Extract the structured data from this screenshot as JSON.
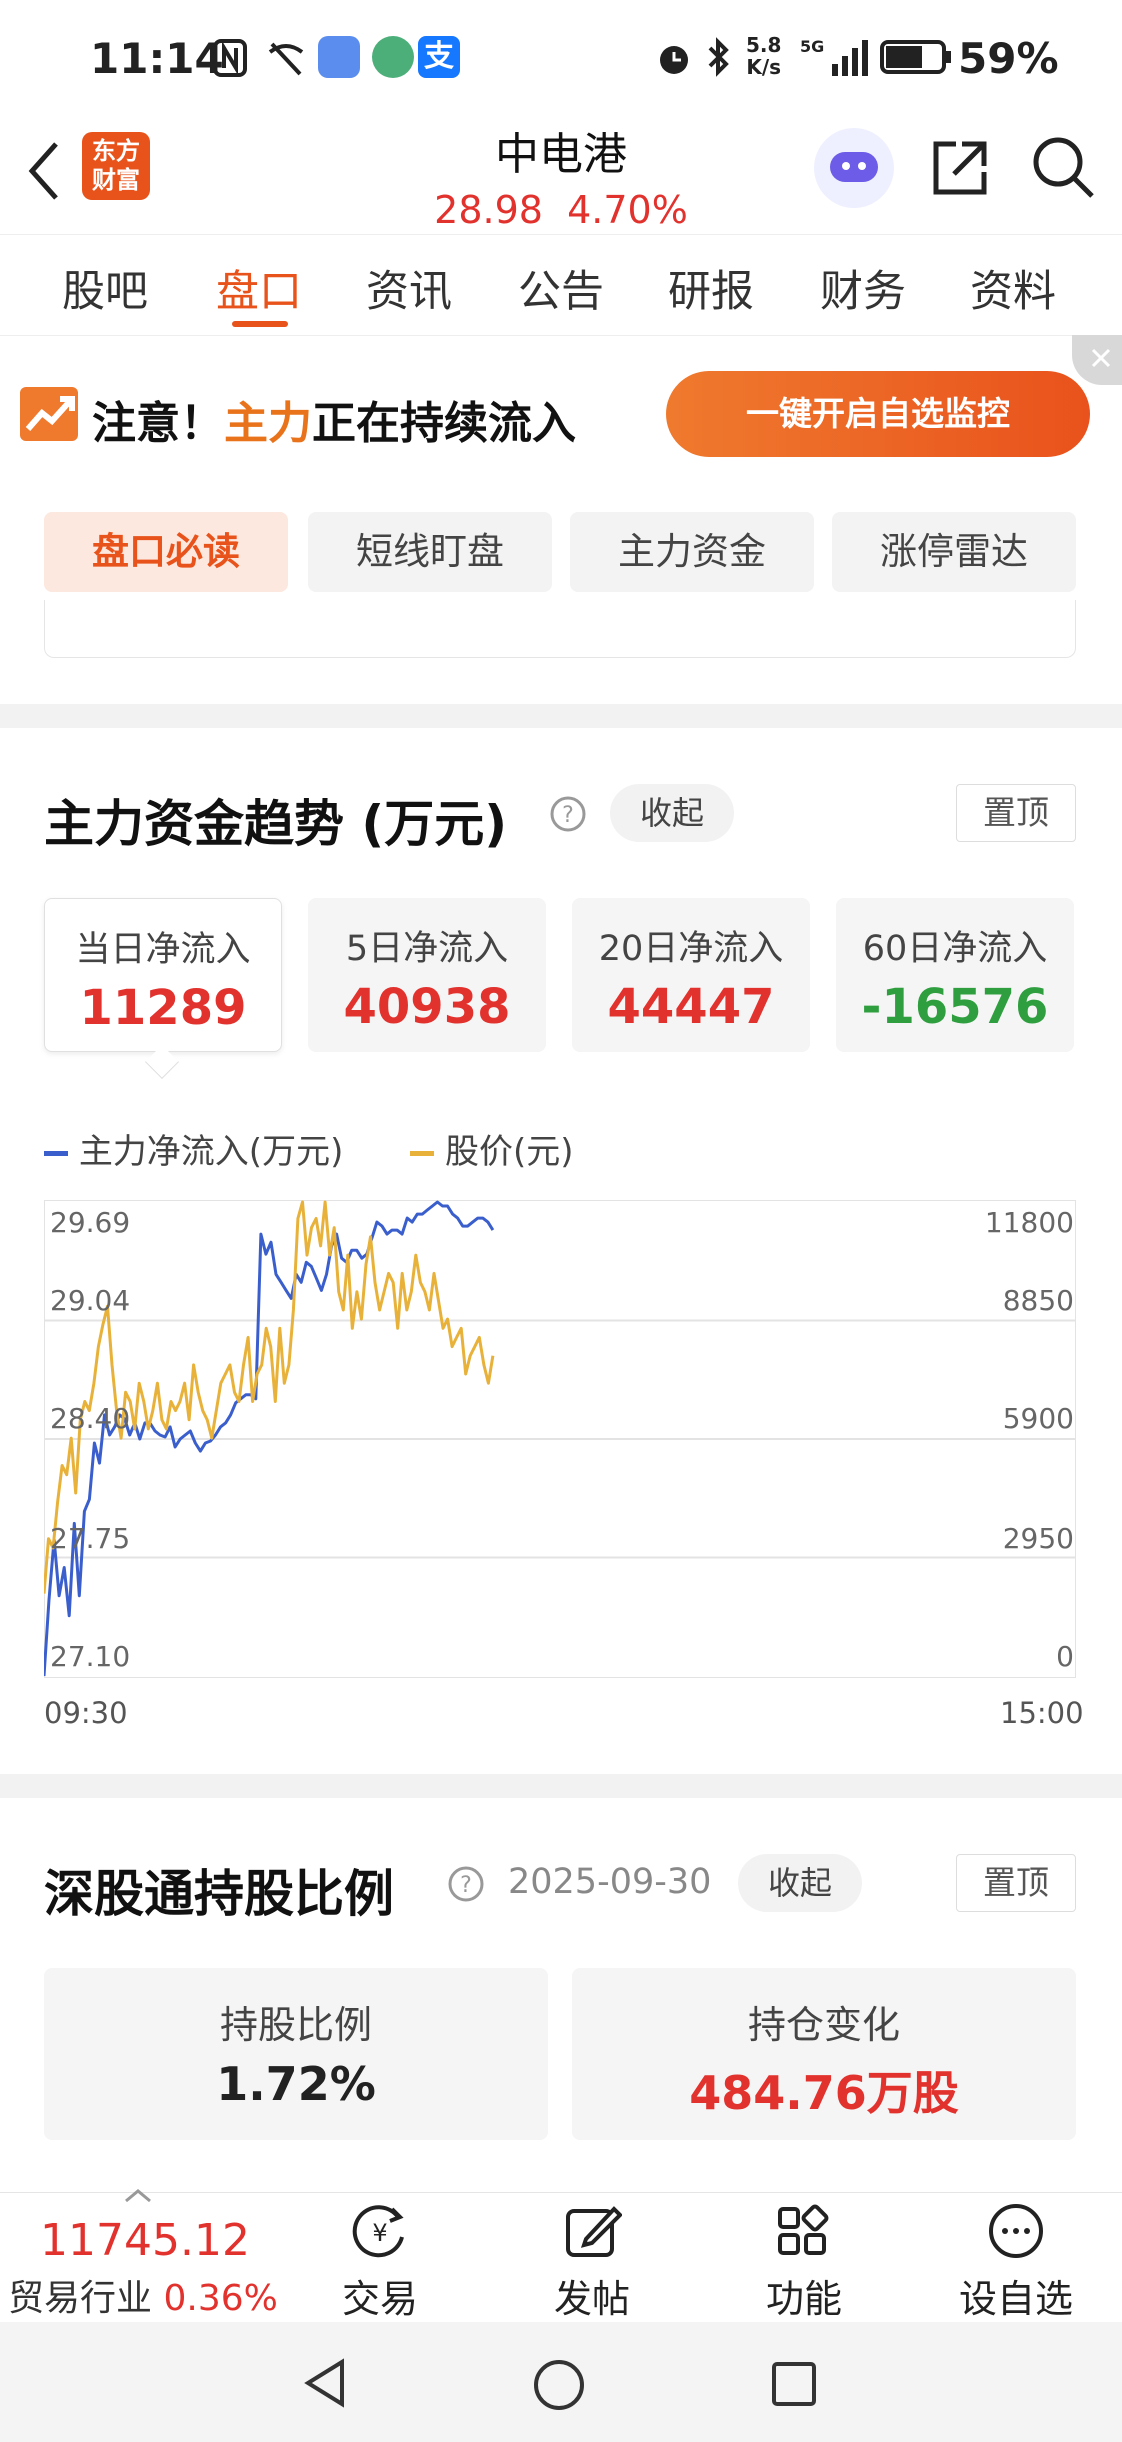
{
  "status_bar": {
    "time": "11:14",
    "net_speed_top": "5.8",
    "net_speed_unit": "K/s",
    "battery": "59%"
  },
  "header": {
    "logo_text_line1": "东方",
    "logo_text_line2": "财富",
    "stock_name": "中电港",
    "price": "28.98",
    "change_pct": "4.70%"
  },
  "tabs": [
    "股吧",
    "盘口",
    "资讯",
    "公告",
    "研报",
    "财务",
    "资料"
  ],
  "active_tab": "盘口",
  "banner": {
    "text_prefix": "注意！",
    "text_highlight": "主力",
    "text_suffix": "正在持续流入",
    "button_label": "一键开启自选监控"
  },
  "subtabs": [
    "盘口必读",
    "短线盯盘",
    "主力资金",
    "涨停雷达"
  ],
  "fund_trend": {
    "title": "主力资金趋势 (万元)",
    "collapse_label": "收起",
    "pin_label": "置顶",
    "cards": [
      {
        "label": "当日净流入",
        "value": "11289",
        "tone": "red"
      },
      {
        "label": "5日净流入",
        "value": "40938",
        "tone": "red"
      },
      {
        "label": "20日净流入",
        "value": "44447",
        "tone": "red"
      },
      {
        "label": "60日净流入",
        "value": "-16576",
        "tone": "green"
      }
    ]
  },
  "chart_data": {
    "type": "line",
    "series": [
      {
        "name": "主力净流入(万元)",
        "color": "#3a5fcd",
        "axis": "right",
        "values": [
          0,
          1900,
          3400,
          2000,
          2700,
          1500,
          3800,
          2000,
          4100,
          4400,
          5800,
          5300,
          6500,
          6000,
          6200,
          6500,
          6400,
          6000,
          6300,
          5900,
          6300,
          6300,
          6100,
          6000,
          5950,
          6200,
          5700,
          5900,
          6000,
          6100,
          5800,
          5600,
          5800,
          5850,
          6000,
          6200,
          6300,
          6500,
          6800,
          6900,
          7000,
          7000,
          6900,
          11000,
          10500,
          10800,
          10000,
          9800,
          9600,
          9400,
          10000,
          9800,
          10300,
          10200,
          9900,
          9600,
          10000,
          10700,
          11000,
          10400,
          10300,
          10600,
          10600,
          10400,
          10500,
          10900,
          11300,
          11200,
          11000,
          11100,
          11100,
          11000,
          11400,
          11300,
          11500,
          11500,
          11600,
          11700,
          11800,
          11700,
          11700,
          11500,
          11400,
          11200,
          11200,
          11300,
          11400,
          11400,
          11300,
          11100
        ]
      },
      {
        "name": "股价(元)",
        "color": "#e8b23a",
        "axis": "left",
        "values": [
          27.55,
          27.85,
          27.8,
          28.05,
          28.25,
          28.2,
          28.4,
          28.1,
          28.5,
          28.6,
          28.55,
          28.7,
          28.9,
          29.02,
          29.12,
          28.8,
          28.55,
          28.4,
          28.65,
          28.6,
          28.45,
          28.7,
          28.6,
          28.45,
          28.55,
          28.7,
          28.5,
          28.45,
          28.6,
          28.55,
          28.6,
          28.7,
          28.5,
          28.8,
          28.65,
          28.55,
          28.5,
          28.4,
          28.55,
          28.7,
          28.75,
          28.8,
          28.65,
          28.6,
          28.8,
          28.95,
          28.6,
          28.75,
          28.8,
          29.0,
          28.9,
          28.6,
          29.0,
          28.7,
          28.8,
          29.1,
          29.6,
          29.7,
          29.4,
          29.55,
          29.6,
          29.45,
          29.7,
          29.4,
          29.55,
          29.2,
          29.1,
          29.4,
          29.0,
          29.2,
          29.05,
          29.35,
          29.5,
          29.25,
          29.1,
          29.2,
          29.3,
          29.25,
          29.0,
          29.3,
          29.1,
          29.2,
          29.4,
          29.25,
          29.2,
          29.1,
          29.3,
          29.15,
          29.0,
          29.05,
          28.9,
          28.95,
          29.0,
          28.75,
          28.85,
          28.9,
          28.95,
          28.8,
          28.7,
          28.85
        ]
      }
    ],
    "left_axis_ticks": [
      "29.69",
      "29.04",
      "28.40",
      "27.75",
      "27.10"
    ],
    "right_axis_ticks": [
      "11800",
      "8850",
      "5900",
      "2950",
      "0"
    ],
    "x_labels": [
      "09:30",
      "15:00"
    ],
    "left_ylim": [
      27.1,
      29.69
    ],
    "right_ylim": [
      0,
      11800
    ],
    "session_fraction": 0.435,
    "legend_position": "top-left",
    "grid": true
  },
  "sz_connect": {
    "title": "深股通持股比例",
    "date": "2025-09-30",
    "collapse_label": "收起",
    "pin_label": "置顶",
    "hold_ratio_label": "持股比例",
    "hold_ratio_value": "1.72%",
    "hold_change_label": "持仓变化",
    "hold_change_value": "484.76万股"
  },
  "bottom_bar": {
    "index_value": "11745.12",
    "industry_name": "贸易行业",
    "industry_change": "0.36%",
    "items": [
      {
        "label": "交易",
        "icon": "yen-refresh-icon"
      },
      {
        "label": "发帖",
        "icon": "edit-icon"
      },
      {
        "label": "功能",
        "icon": "grid-icon"
      },
      {
        "label": "设自选",
        "icon": "more-dots-icon"
      }
    ]
  },
  "colors": {
    "accent": "#e8531b",
    "rise": "#e1322e",
    "fall": "#2e9e3e",
    "flow_line": "#3a5fcd",
    "price_line": "#e8b23a"
  }
}
